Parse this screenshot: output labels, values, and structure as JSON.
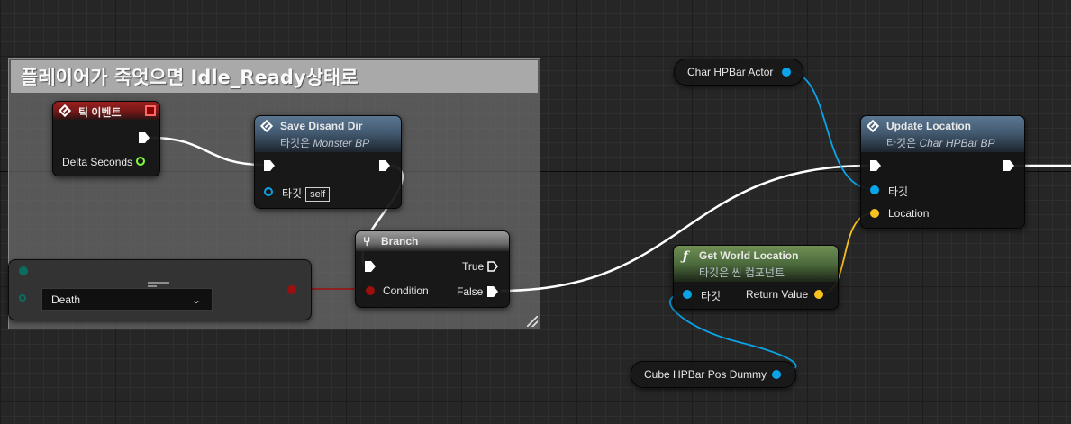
{
  "comment": {
    "title": "플레이어가 죽엇으면 Idle_Ready상태로"
  },
  "tick_event": {
    "title": "틱 이벤트",
    "delta_seconds_label": "Delta Seconds"
  },
  "save_disand_dir": {
    "title": "Save Disand Dir",
    "target_prefix": "타깃은",
    "target_class": "Monster BP",
    "target_pin_label": "타깃",
    "self_label": "self"
  },
  "branch": {
    "title": "Branch",
    "condition_label": "Condition",
    "true_label": "True",
    "false_label": "False"
  },
  "enum_node": {
    "selected_value": "Death"
  },
  "char_hpbar_actor": {
    "label": "Char HPBar Actor"
  },
  "update_location": {
    "title": "Update Location",
    "target_prefix": "타깃은",
    "target_class": "Char HPBar BP",
    "target_pin_label": "타깃",
    "location_label": "Location"
  },
  "get_world_location": {
    "title": "Get World Location",
    "subtitle": "타깃은 씬 컴포넌트",
    "target_pin_label": "타깃",
    "return_value_label": "Return Value"
  },
  "cube_hpbar_pos_dummy": {
    "label": "Cube HPBar Pos Dummy"
  },
  "colors": {
    "exec_wire": "#ffffff",
    "object_pin": "#0aa4e8",
    "vector_pin": "#f7c21f",
    "bool_pin": "#9c0f0f",
    "float_pin": "#7dff3a",
    "enum_pin": "#0a6d5e"
  }
}
